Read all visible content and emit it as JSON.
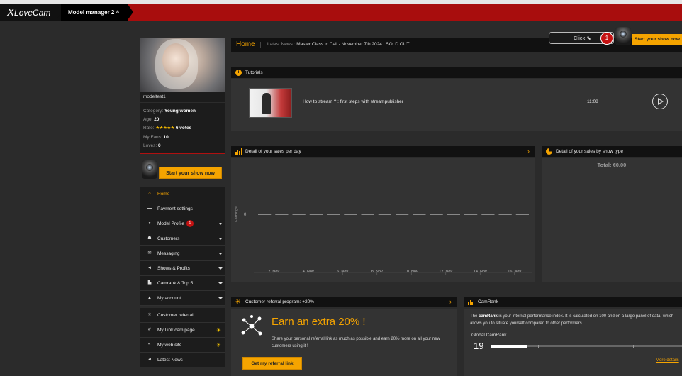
{
  "header": {
    "logo_text": "LoveCam",
    "logo_letter": "X",
    "model_tab": "Model manager 2 ˄"
  },
  "profile": {
    "name": "modeltest1",
    "category_label": "Category:",
    "category": "Young women",
    "age_label": "Age:",
    "age": "20",
    "rate_label": "Rate:",
    "stars": "★★★★★",
    "votes": "6 votes",
    "fans_label": "My Fans:",
    "fans": "10",
    "loves_label": "Loves:",
    "loves": "0"
  },
  "start_show": {
    "label": "Start your show now"
  },
  "start_show_top": {
    "label": "Start your show now"
  },
  "nav": {
    "items": [
      {
        "label": "Home",
        "icon": "home-icon"
      },
      {
        "label": "Payment settings",
        "icon": "card-icon"
      },
      {
        "label": "Model Profile",
        "icon": "profile-icon",
        "badge": "1"
      },
      {
        "label": "Customers",
        "icon": "customers-icon"
      },
      {
        "label": "Messaging",
        "icon": "mail-icon"
      },
      {
        "label": "Shows & Profits",
        "icon": "shows-icon"
      },
      {
        "label": "Camrank & Top 5",
        "icon": "chart-icon"
      },
      {
        "label": "My account",
        "icon": "user-icon"
      },
      {
        "label": "Customer referral",
        "icon": "referral-icon"
      },
      {
        "label": "My Link.cam page",
        "icon": "link-icon"
      },
      {
        "label": "My web site",
        "icon": "web-icon"
      },
      {
        "label": "Latest News",
        "icon": "news-icon"
      }
    ]
  },
  "homebar": {
    "title": "Home",
    "news_label": "Latest News :",
    "news_text": "Master Class in Cali - November 7th 2024 : SOLD OUT"
  },
  "click_box": {
    "label": "Click",
    "badge": "1"
  },
  "tutorials": {
    "title": "Tutorials",
    "item_title": "How to stream ? : first steps with streampublisher",
    "duration": "11:08"
  },
  "sales_day": {
    "title": "Detail of your sales per day"
  },
  "sales_type": {
    "title": "Detail of your sales by show type",
    "total": "Total: €0.00"
  },
  "chart_data": {
    "type": "line",
    "title": "",
    "xlabel": "",
    "ylabel": "Earnings",
    "categories": [
      "2. Nov",
      "4. Nov",
      "6. Nov",
      "8. Nov",
      "10. Nov",
      "12. Nov",
      "14. Nov",
      "16. Nov"
    ],
    "series": [
      {
        "name": "",
        "values": [
          0,
          0,
          0,
          0,
          0,
          0,
          0,
          0
        ]
      }
    ],
    "yticks": [
      "0"
    ],
    "grid": false,
    "line_color": "#dddddd"
  },
  "referral": {
    "title": "Customer referral program: +20%",
    "headline": "Earn an extra 20% !",
    "text": "Share your personal referral link as much as possible and earn 20% more on all your new customers using it !",
    "button": "Get my referral link"
  },
  "camrank": {
    "title": "CamRank",
    "desc_pre": "The ",
    "desc_bold": "camRank",
    "desc_post": " is your internal performance index. It is calculated on 100 and on a large panel of data, which allows you to situate yourself compared to other performers.",
    "global_label": "Global CamRank",
    "value": "19",
    "value_fraction": 0.19,
    "more": "More details"
  },
  "colors": {
    "accent": "#f5a400",
    "brand_red": "#a80d0d"
  }
}
